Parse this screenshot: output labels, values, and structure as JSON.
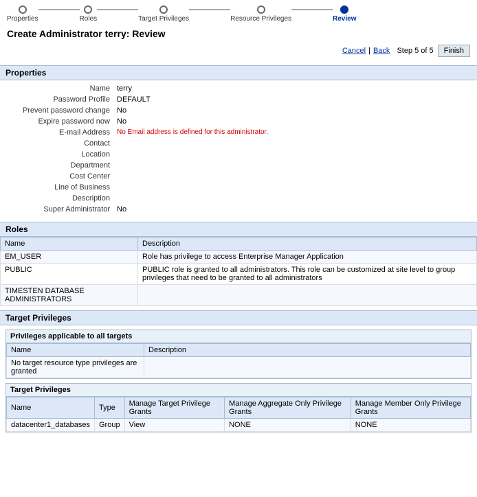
{
  "wizard": {
    "steps": [
      {
        "id": "properties",
        "label": "Properties",
        "active": false
      },
      {
        "id": "roles",
        "label": "Roles",
        "active": false
      },
      {
        "id": "target-privileges",
        "label": "Target Privileges",
        "active": false
      },
      {
        "id": "resource-privileges",
        "label": "Resource Privileges",
        "active": false
      },
      {
        "id": "review",
        "label": "Review",
        "active": true
      }
    ],
    "step_info": "Step 5 of 5"
  },
  "page": {
    "title": "Create Administrator terry: Review"
  },
  "toolbar": {
    "cancel": "Cancel",
    "back": "Back",
    "finish": "Finish"
  },
  "properties": {
    "section_title": "Properties",
    "fields": [
      {
        "label": "Name",
        "value": "terry",
        "note": false
      },
      {
        "label": "Password Profile",
        "value": "DEFAULT",
        "note": false
      },
      {
        "label": "Prevent password change",
        "value": "No",
        "note": false
      },
      {
        "label": "Expire password now",
        "value": "No",
        "note": false
      },
      {
        "label": "E-mail Address",
        "value": "No Email address is defined for this administrator.",
        "note": true
      },
      {
        "label": "Contact",
        "value": "",
        "note": false
      },
      {
        "label": "Location",
        "value": "",
        "note": false
      },
      {
        "label": "Department",
        "value": "",
        "note": false
      },
      {
        "label": "Cost Center",
        "value": "",
        "note": false
      },
      {
        "label": "Line of Business",
        "value": "",
        "note": false
      },
      {
        "label": "Description",
        "value": "",
        "note": false
      },
      {
        "label": "Super Administrator",
        "value": "No",
        "note": false
      }
    ]
  },
  "roles": {
    "section_title": "Roles",
    "columns": [
      "Name",
      "Description"
    ],
    "rows": [
      {
        "name": "EM_USER",
        "description": "Role has privilege to access Enterprise Manager Application"
      },
      {
        "name": "PUBLIC",
        "description": "PUBLIC role is granted to all administrators. This role can be customized at site level to group privileges that need to be granted to all administrators"
      },
      {
        "name": "TIMESTEN DATABASE ADMINISTRATORS",
        "description": ""
      }
    ]
  },
  "target_privileges": {
    "section_title": "Target Privileges",
    "sub1": {
      "title": "Privileges applicable to all targets",
      "columns": [
        "Name",
        "Description"
      ],
      "rows": [
        {
          "name": "No target resource type privileges are granted",
          "description": ""
        }
      ]
    },
    "sub2": {
      "title": "Target Privileges",
      "columns": [
        "Name",
        "Type",
        "Manage Target Privilege Grants",
        "Manage Aggregate Only Privilege Grants",
        "Manage Member Only Privilege Grants"
      ],
      "rows": [
        {
          "name": "datacenter1_databases",
          "type": "Group",
          "col3": "View",
          "col4": "NONE",
          "col5": "NONE"
        }
      ]
    }
  }
}
